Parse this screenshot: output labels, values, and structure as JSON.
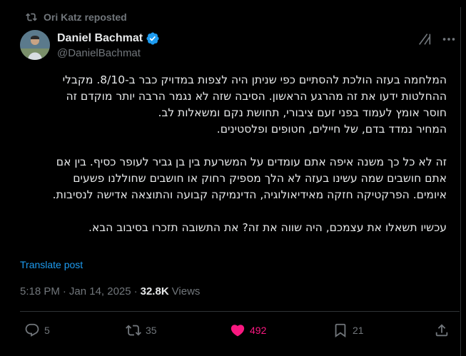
{
  "repost": {
    "icon": "repost-icon",
    "text": "Ori Katz reposted"
  },
  "author": {
    "name": "Daniel Bachmat",
    "handle": "@DanielBachmat",
    "verified": true,
    "badge_color": "#1d9bf0"
  },
  "tweet": {
    "lines": [
      "המלחמה בעזה הולכת להסתיים כפי שניתן היה לצפות במדויק כבר ב-8/10. מקבלי",
      "ההחלטות ידעו את זה מהרגע הראשון. הסיבה שזה לא נגמר הרבה יותר מוקדם זה",
      "חוסר אומץ לעמוד בפני זעם ציבורי, תחושת נקם ומשאלות לב.",
      "המחיר נמדד בדם, של חיילים, חטופים ופלסטינים.",
      "",
      "זה לא כל כך משנה איפה אתם עומדים על המשרעת בין בן גביר לעופר כסיף. בין אם",
      "אתם חושבים שמה עשינו בעזה לא הלך מספיק רחוק או חושבים שחוללנו פשעים",
      "איומים. הפרקטיקה חזקה מאידיאולוגיה, הדינמיקה קבועה והתוצאה אדישה לנסיבות.",
      "",
      "עכשיו תשאלו את עצמכם, היה שווה את זה? את התשובה תזכרו בסיבוב הבא."
    ],
    "translate_label": "Translate post"
  },
  "meta": {
    "time": "5:18 PM",
    "separator": "·",
    "date": "Jan 14, 2025",
    "views_count": "32.8K",
    "views_label": "Views"
  },
  "actions": {
    "replies": "5",
    "reposts": "35",
    "likes": "492",
    "bookmarks": "21"
  },
  "colors": {
    "background": "#000000",
    "text": "#e7e9ea",
    "muted": "#71767b",
    "link": "#1d9bf0",
    "like": "#f91880"
  },
  "icons": [
    "repost-icon",
    "verified-badge-icon",
    "grok-icon",
    "more-icon",
    "reply-icon",
    "retweet-icon",
    "heart-icon",
    "bookmark-icon",
    "share-icon"
  ]
}
